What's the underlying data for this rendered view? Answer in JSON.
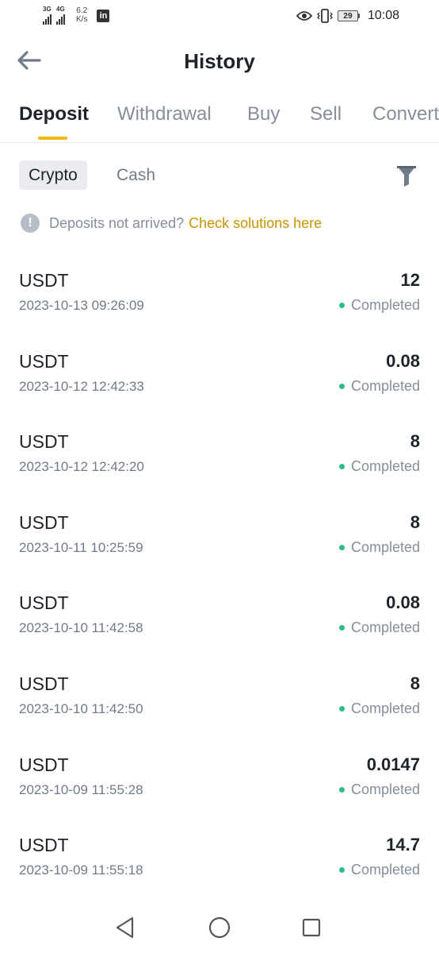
{
  "status_bar": {
    "sig1_label": "3G",
    "sig2_label": "4G",
    "speed_value": "6.2",
    "speed_unit": "K/s",
    "linkedin_label": "in",
    "battery_level": "29",
    "time": "10:08"
  },
  "header": {
    "title": "History"
  },
  "tabs": [
    {
      "label": "Deposit",
      "active": true
    },
    {
      "label": "Withdrawal",
      "active": false
    },
    {
      "label": "Buy",
      "active": false
    },
    {
      "label": "Sell",
      "active": false
    },
    {
      "label": "Convert",
      "active": false
    }
  ],
  "sub_filter": {
    "crypto_label": "Crypto",
    "cash_label": "Cash"
  },
  "notice": {
    "text": "Deposits not arrived?",
    "link": "Check solutions here",
    "icon": "!"
  },
  "deposits": [
    {
      "coin": "USDT",
      "date": "2023-10-13 09:26:09",
      "amount": "12",
      "status": "Completed"
    },
    {
      "coin": "USDT",
      "date": "2023-10-12 12:42:33",
      "amount": "0.08",
      "status": "Completed"
    },
    {
      "coin": "USDT",
      "date": "2023-10-12 12:42:20",
      "amount": "8",
      "status": "Completed"
    },
    {
      "coin": "USDT",
      "date": "2023-10-11 10:25:59",
      "amount": "8",
      "status": "Completed"
    },
    {
      "coin": "USDT",
      "date": "2023-10-10 11:42:58",
      "amount": "0.08",
      "status": "Completed"
    },
    {
      "coin": "USDT",
      "date": "2023-10-10 11:42:50",
      "amount": "8",
      "status": "Completed"
    },
    {
      "coin": "USDT",
      "date": "2023-10-09 11:55:28",
      "amount": "0.0147",
      "status": "Completed"
    },
    {
      "coin": "USDT",
      "date": "2023-10-09 11:55:18",
      "amount": "14.7",
      "status": "Completed"
    }
  ],
  "colors": {
    "accent": "#f0b90b",
    "link": "#c99400",
    "success": "#2ebd85",
    "text_primary": "#1e2329",
    "text_secondary": "#848e9c"
  },
  "icons": {
    "back": "arrow-left-icon",
    "filter": "funnel-icon",
    "notice": "exclamation-circle-icon",
    "nav_back": "triangle-back-icon",
    "nav_home": "circle-home-icon",
    "nav_recent": "square-recent-icon"
  }
}
